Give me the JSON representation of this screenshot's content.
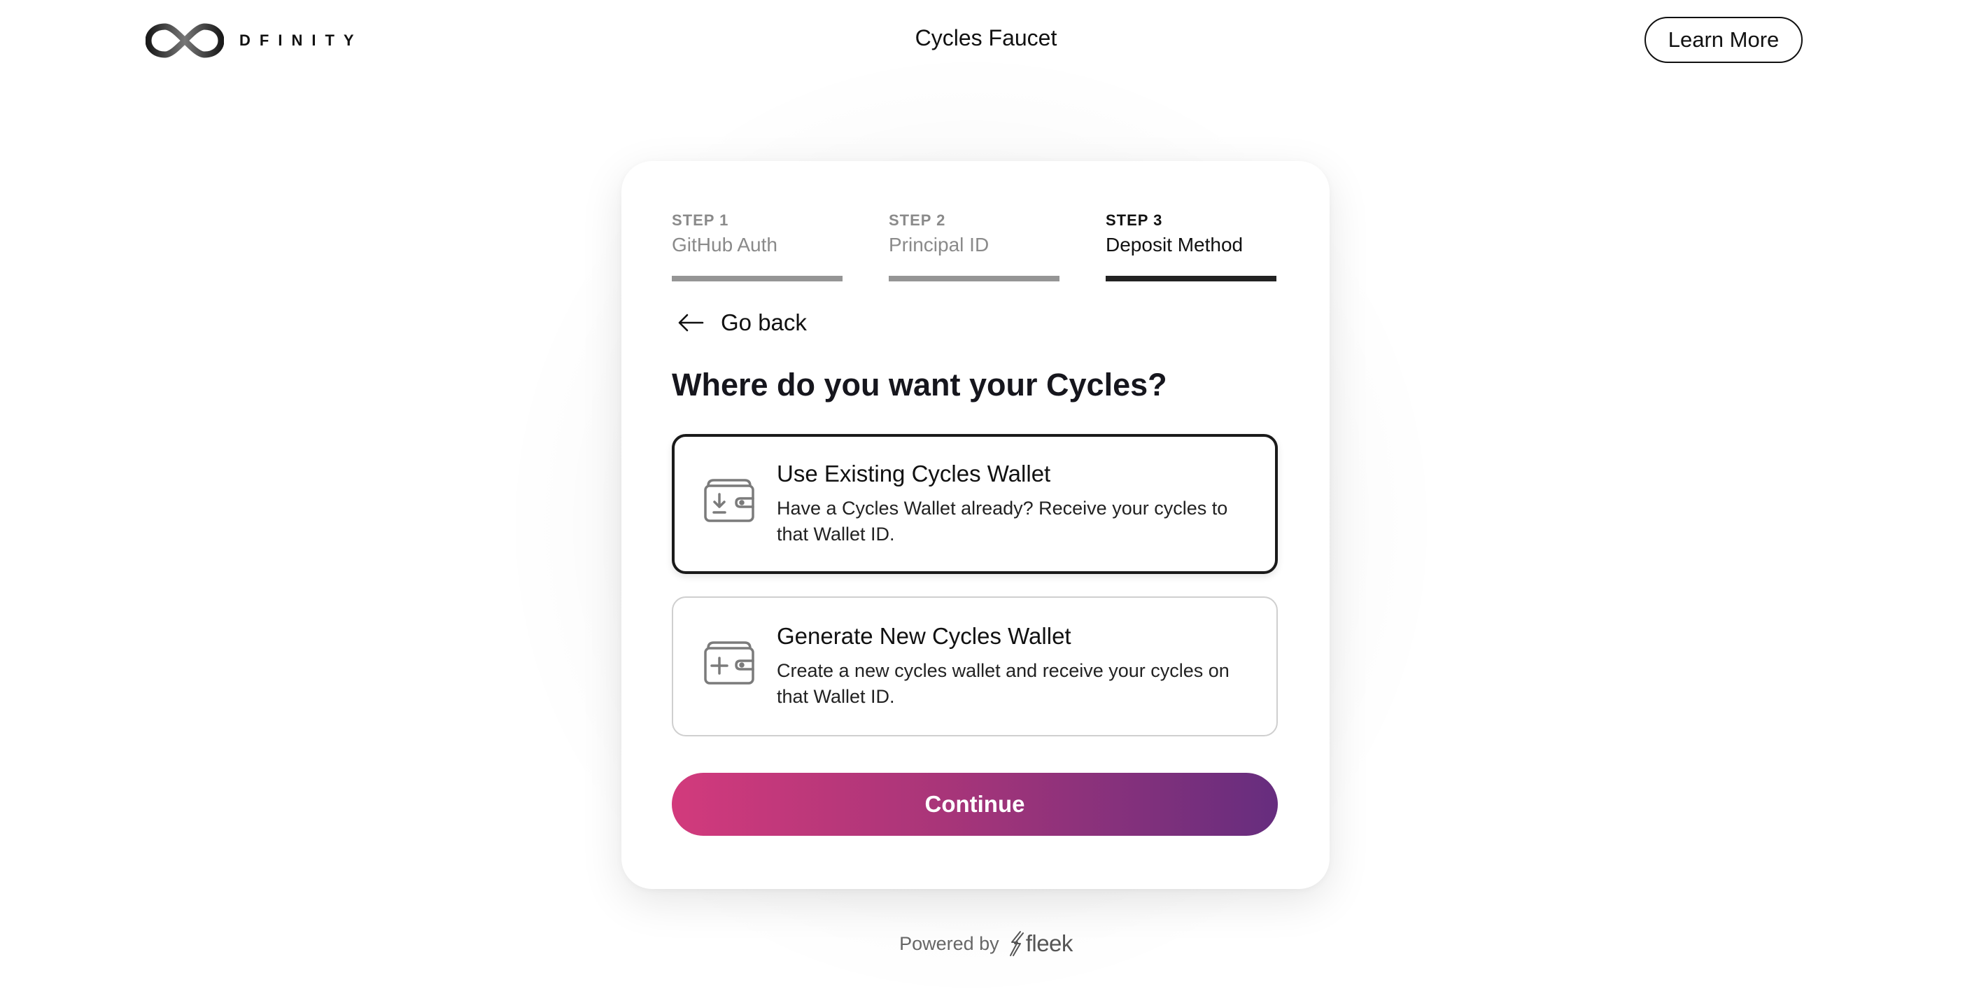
{
  "header": {
    "logo_text": "DFINITY",
    "title": "Cycles Faucet",
    "learn_more_label": "Learn More"
  },
  "steps": [
    {
      "number": "STEP 1",
      "label": "GitHub Auth",
      "state": "completed"
    },
    {
      "number": "STEP 2",
      "label": "Principal ID",
      "state": "completed"
    },
    {
      "number": "STEP 3",
      "label": "Deposit Method",
      "state": "active"
    }
  ],
  "go_back_label": "Go back",
  "question": "Where do you want your Cycles?",
  "options": [
    {
      "title": "Use Existing Cycles Wallet",
      "description": "Have a Cycles Wallet already? Receive your cycles to that Wallet ID.",
      "icon": "wallet-download-icon",
      "selected": true
    },
    {
      "title": "Generate New Cycles Wallet",
      "description": "Create a new cycles wallet and receive your cycles on that Wallet ID.",
      "icon": "wallet-plus-icon",
      "selected": false
    }
  ],
  "continue_label": "Continue",
  "footer": {
    "powered_by": "Powered by",
    "brand": "fleek"
  },
  "colors": {
    "gradient_start": "#d23a7c",
    "gradient_end": "#662d7e",
    "step_active": "#222222",
    "step_inactive": "#959595"
  }
}
